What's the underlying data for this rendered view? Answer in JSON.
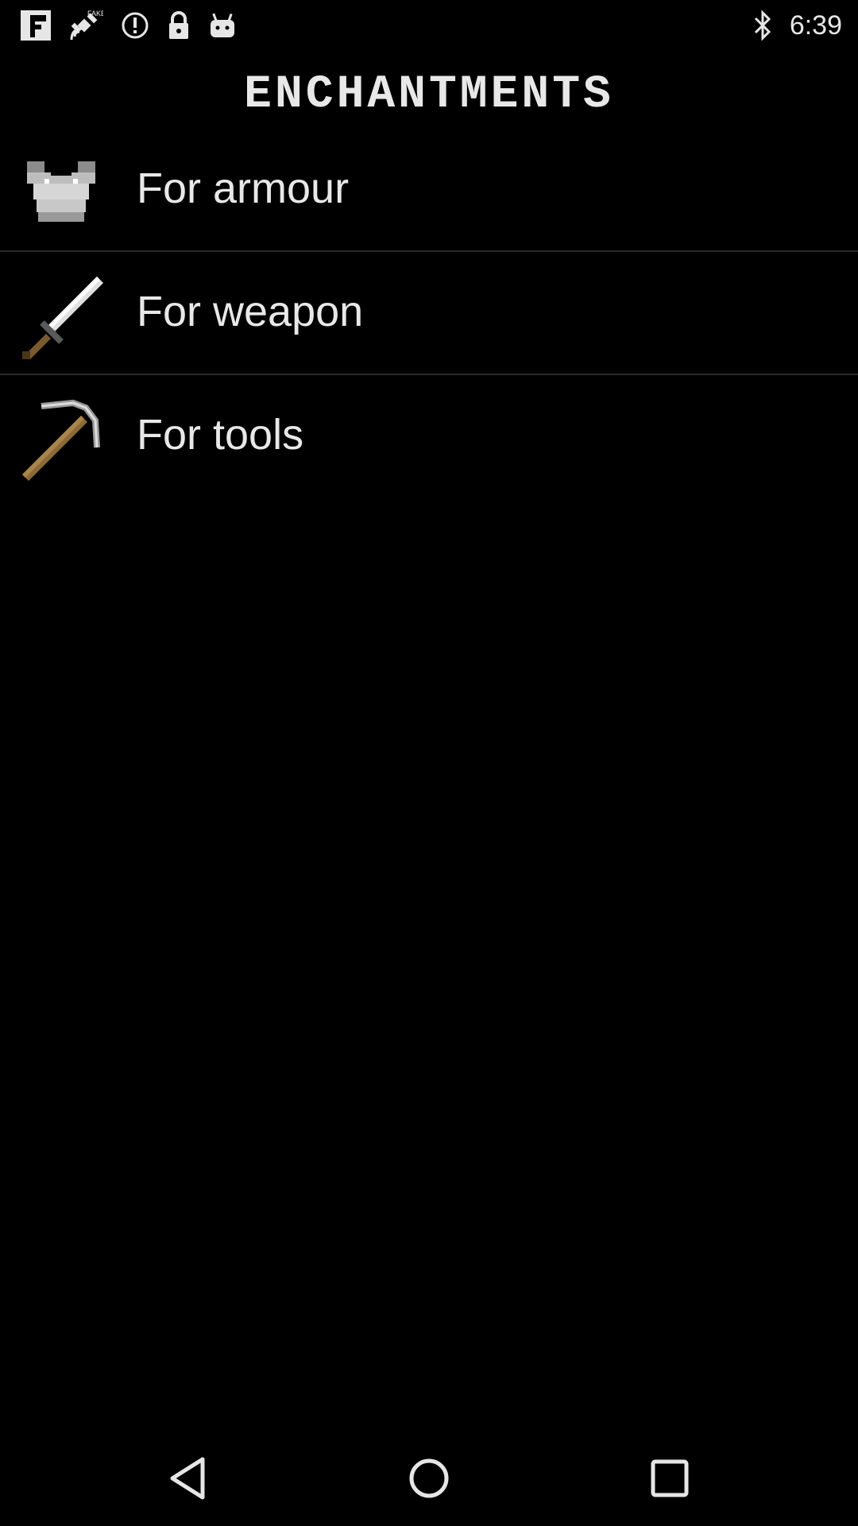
{
  "status_bar": {
    "time": "6:39",
    "left_icons": [
      "flipboard-icon",
      "fake-gps-icon",
      "alert-icon",
      "lock-icon",
      "android-icon"
    ],
    "right_icons": [
      "bluetooth-icon"
    ]
  },
  "page": {
    "title": "ENCHANTMENTS"
  },
  "menu": {
    "items": [
      {
        "label": "For armour",
        "icon": "chestplate-icon"
      },
      {
        "label": "For weapon",
        "icon": "sword-icon"
      },
      {
        "label": "For tools",
        "icon": "pickaxe-icon"
      }
    ]
  },
  "nav": {
    "back": "back-icon",
    "home": "home-icon",
    "recents": "recents-icon"
  },
  "colors": {
    "background": "#000000",
    "text": "#e8e8e8",
    "divider": "#2a2a2a"
  }
}
